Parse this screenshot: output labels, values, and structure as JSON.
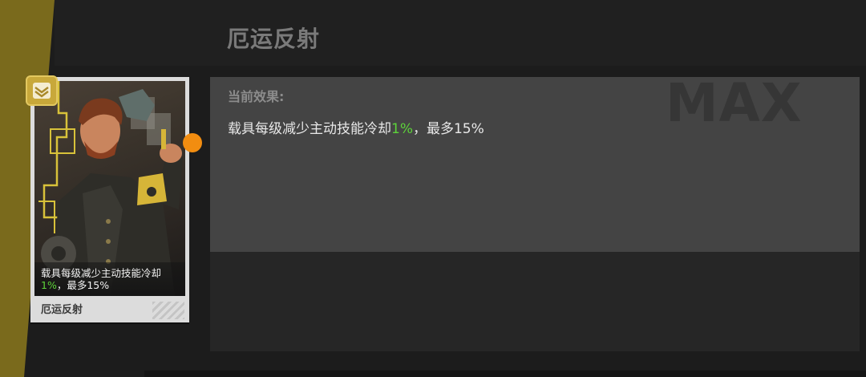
{
  "page": {
    "title": "厄运反射"
  },
  "effect": {
    "heading": "当前效果:",
    "text_prefix": "载具每级减少主动技能冷却",
    "text_highlight": "1%",
    "text_suffix": "，最多15%",
    "level_label": "MAX"
  },
  "card": {
    "desc_line1": "载具每级减少主动技能冷却",
    "desc_highlight": "1%",
    "desc_suffix": "，最多15%",
    "name": "厄运反射",
    "badge_icon": "crossed-wings-icon"
  },
  "colors": {
    "accent_gold": "#7a6a1c",
    "highlight_green": "#5dd33a",
    "indicator_orange": "#f28d10"
  }
}
